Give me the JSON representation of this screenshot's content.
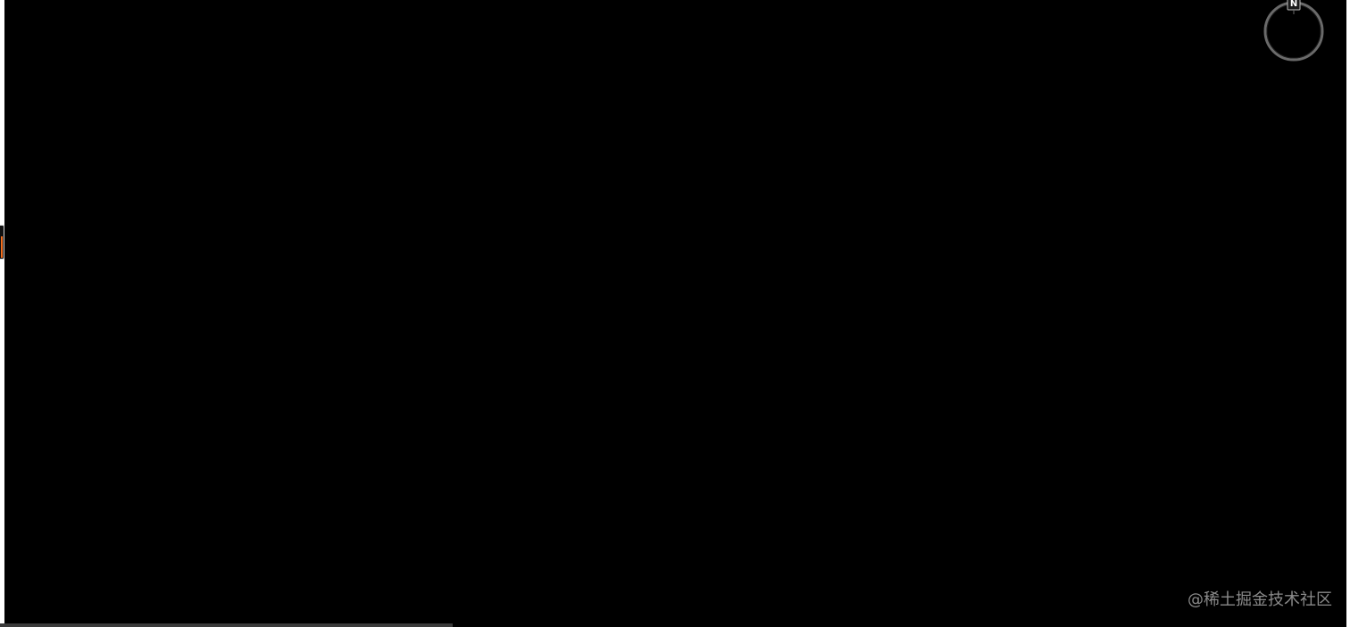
{
  "viewer": {
    "background": "#000000",
    "compass": {
      "icon": "compass-icon",
      "north_label": "N"
    },
    "left_handle": {
      "icon": "side-panel-handle",
      "accent_color": "#f36d1d"
    },
    "watermark": "@稀土掘金技术社区"
  }
}
